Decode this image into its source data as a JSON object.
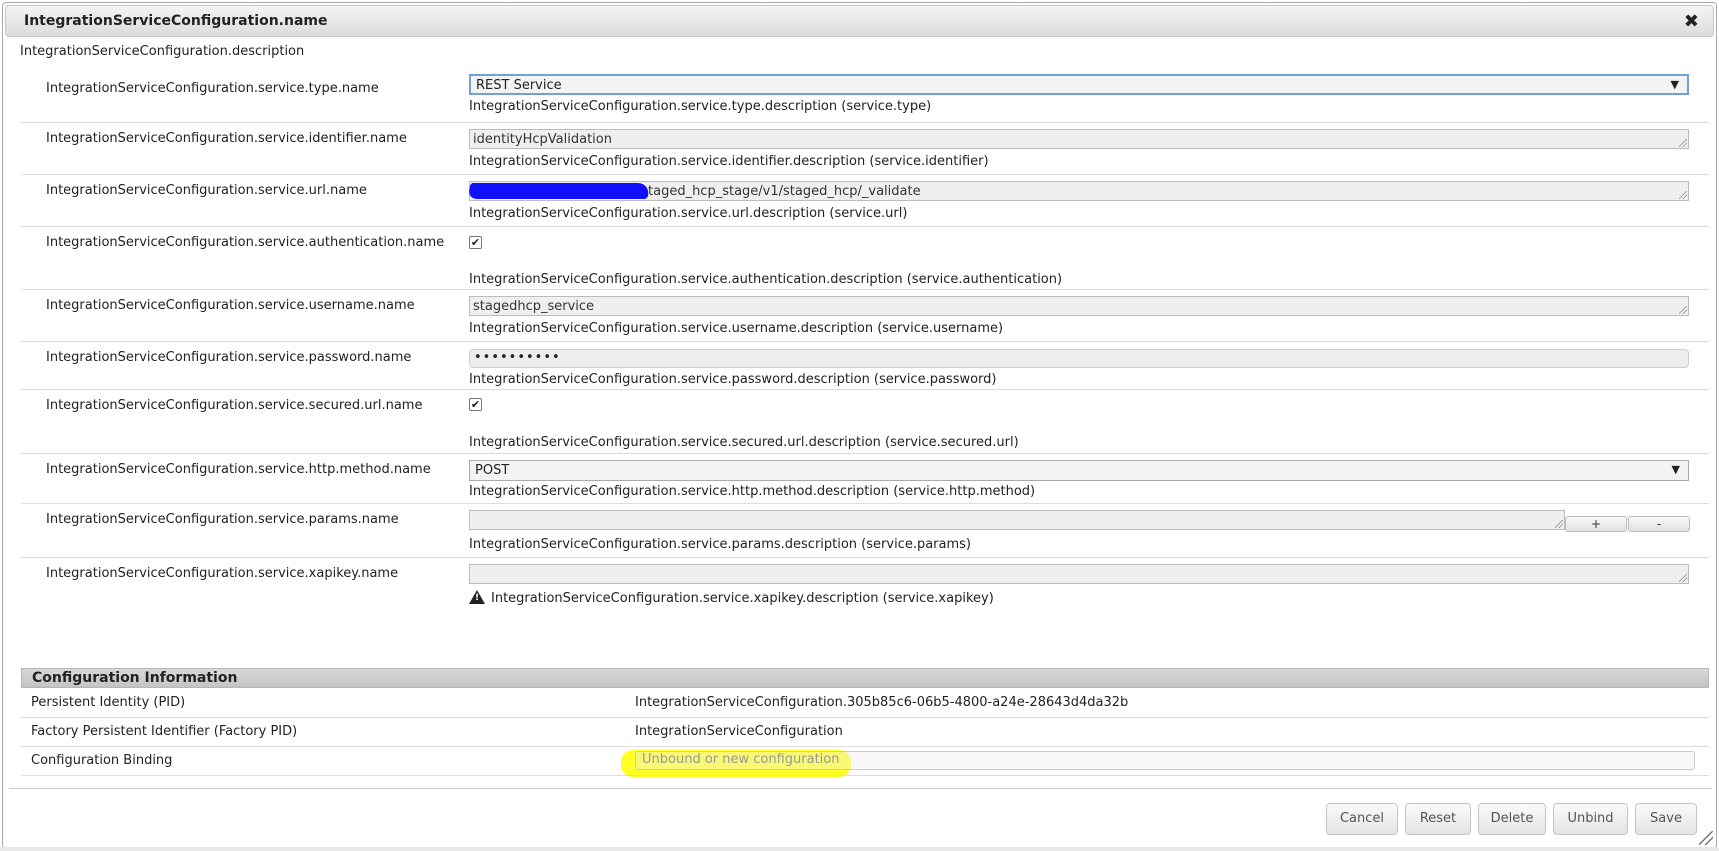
{
  "dialog": {
    "title": "IntegrationServiceConfiguration.name",
    "description": "IntegrationServiceConfiguration.description",
    "close_glyph": "✖"
  },
  "fields": {
    "type": {
      "label": "IntegrationServiceConfiguration.service.type.name",
      "value": "REST Service",
      "description": "IntegrationServiceConfiguration.service.type.description (service.type)"
    },
    "identifier": {
      "label": "IntegrationServiceConfiguration.service.identifier.name",
      "value": "identityHcpValidation",
      "description": "IntegrationServiceConfiguration.service.identifier.description (service.identifier)"
    },
    "url": {
      "label": "IntegrationServiceConfiguration.service.url.name",
      "value": "taged_hcp_stage/v1/staged_hcp/_validate",
      "description": "IntegrationServiceConfiguration.service.url.description (service.url)"
    },
    "authentication": {
      "label": "IntegrationServiceConfiguration.service.authentication.name",
      "checked": true,
      "description": "IntegrationServiceConfiguration.service.authentication.description (service.authentication)"
    },
    "username": {
      "label": "IntegrationServiceConfiguration.service.username.name",
      "value": "stagedhcp_service",
      "description": "IntegrationServiceConfiguration.service.username.description (service.username)"
    },
    "password": {
      "label": "IntegrationServiceConfiguration.service.password.name",
      "value": "••••••••••",
      "description": "IntegrationServiceConfiguration.service.password.description (service.password)"
    },
    "secured_url": {
      "label": "IntegrationServiceConfiguration.service.secured.url.name",
      "checked": true,
      "description": "IntegrationServiceConfiguration.service.secured.url.description (service.secured.url)"
    },
    "http_method": {
      "label": "IntegrationServiceConfiguration.service.http.method.name",
      "value": "POST",
      "description": "IntegrationServiceConfiguration.service.http.method.description (service.http.method)"
    },
    "params": {
      "label": "IntegrationServiceConfiguration.service.params.name",
      "value": "",
      "add_label": "+",
      "remove_label": "-",
      "description": "IntegrationServiceConfiguration.service.params.description (service.params)"
    },
    "xapikey": {
      "label": "IntegrationServiceConfiguration.service.xapikey.name",
      "value": "",
      "description": "IntegrationServiceConfiguration.service.xapikey.description (service.xapikey)"
    }
  },
  "info": {
    "header": "Configuration Information",
    "pid_label": "Persistent Identity (PID)",
    "pid_value": "IntegrationServiceConfiguration.305b85c6-06b5-4800-a24e-28643d4da32b",
    "factory_label": "Factory Persistent Identifier (Factory PID)",
    "factory_value": "IntegrationServiceConfiguration",
    "binding_label": "Configuration Binding",
    "binding_value": "Unbound or new configuration"
  },
  "buttons": {
    "cancel": "Cancel",
    "reset": "Reset",
    "delete": "Delete",
    "unbind": "Unbind",
    "save": "Save"
  },
  "icons": {
    "select_arrow": "▼",
    "checkmark": "✔",
    "warning": "!"
  },
  "colors": {
    "focus_border": "#6fa2d8",
    "highlight": "#ffff00",
    "redaction": "#1010ff"
  }
}
